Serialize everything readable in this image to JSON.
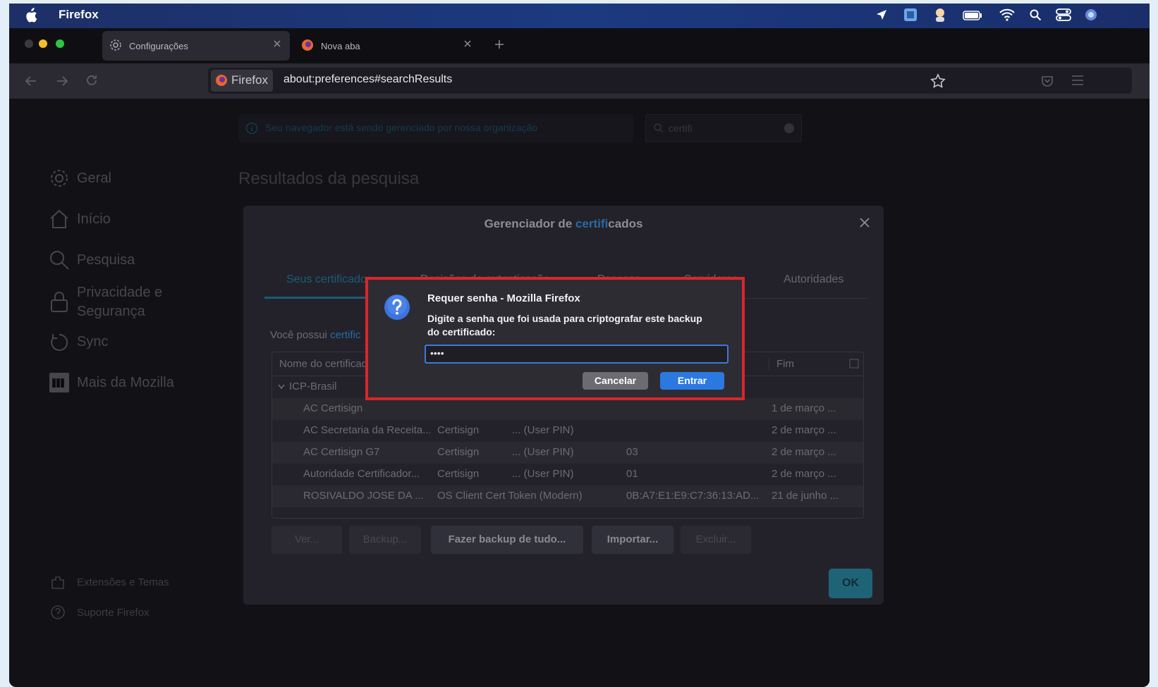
{
  "menubar": {
    "app_name": "Firefox"
  },
  "tabs": [
    {
      "label": "Configurações"
    },
    {
      "label": "Nova aba"
    }
  ],
  "urlbar": {
    "identity": "Firefox",
    "url": "about:preferences#searchResults"
  },
  "page": {
    "notice": "Seu navegador está sendo gerenciado por nossa organização",
    "search_value": "certifi",
    "heading": "Resultados da pesquisa",
    "sidebar": [
      {
        "label": "Geral"
      },
      {
        "label": "Início"
      },
      {
        "label": "Pesquisa"
      },
      {
        "label": "Privacidade e Segurança"
      },
      {
        "label": "Sync"
      },
      {
        "label": "Mais da Mozilla"
      }
    ],
    "sidebar_footer": [
      {
        "label": "Extensões e Temas"
      },
      {
        "label": "Suporte Firefox"
      }
    ]
  },
  "cert_manager": {
    "title_prefix": "Gerenciador de ",
    "title_highlight": "certifi",
    "title_suffix": "cados",
    "tabs": [
      {
        "label": "Seus certificados"
      },
      {
        "label": "Decisões de autenticação"
      },
      {
        "label": "Pessoas"
      },
      {
        "label": "Servidores"
      },
      {
        "label": "Autoridades"
      }
    ],
    "intro_prefix": "Você possui ",
    "intro_highlight": "certific",
    "columns": {
      "name": "Nome do certificado",
      "end": "Fim"
    },
    "group": "ICP-Brasil",
    "rows": [
      {
        "name": "AC Certisign",
        "token": "",
        "device": "",
        "serial": "",
        "end": "1 de março ..."
      },
      {
        "name": "AC Secretaria da Receita...",
        "token": "Certisign",
        "device": "... (User PIN)",
        "serial": "",
        "end": "2 de março ..."
      },
      {
        "name": "AC Certisign G7",
        "token": "Certisign",
        "device": "... (User PIN)",
        "serial": "03",
        "end": "2 de março ..."
      },
      {
        "name": "Autoridade Certificador...",
        "token": "Certisign",
        "device": "... (User PIN)",
        "serial": "01",
        "end": "2 de março ..."
      },
      {
        "name": "ROSIVALDO JOSE DA ...",
        "token": "OS Client Cert Token (Modern)",
        "device": "",
        "serial": "0B:A7:E1:E9:C7:36:13:AD...",
        "end": "21 de junho ..."
      }
    ],
    "buttons": {
      "view": "Ver...",
      "backup": "Backup...",
      "backup_all": "Fazer backup de tudo...",
      "import": "Importar...",
      "delete": "Excluir...",
      "ok": "OK"
    }
  },
  "prompt": {
    "title": "Requer senha - Mozilla Firefox",
    "message": "Digite a senha que foi usada para criptografar este backup do certificado:",
    "password_mask": "••••",
    "cancel": "Cancelar",
    "enter": "Entrar"
  },
  "colors": {
    "accent": "#2b79e0",
    "highlight_border": "#d9262b",
    "link": "#1b5c78"
  }
}
